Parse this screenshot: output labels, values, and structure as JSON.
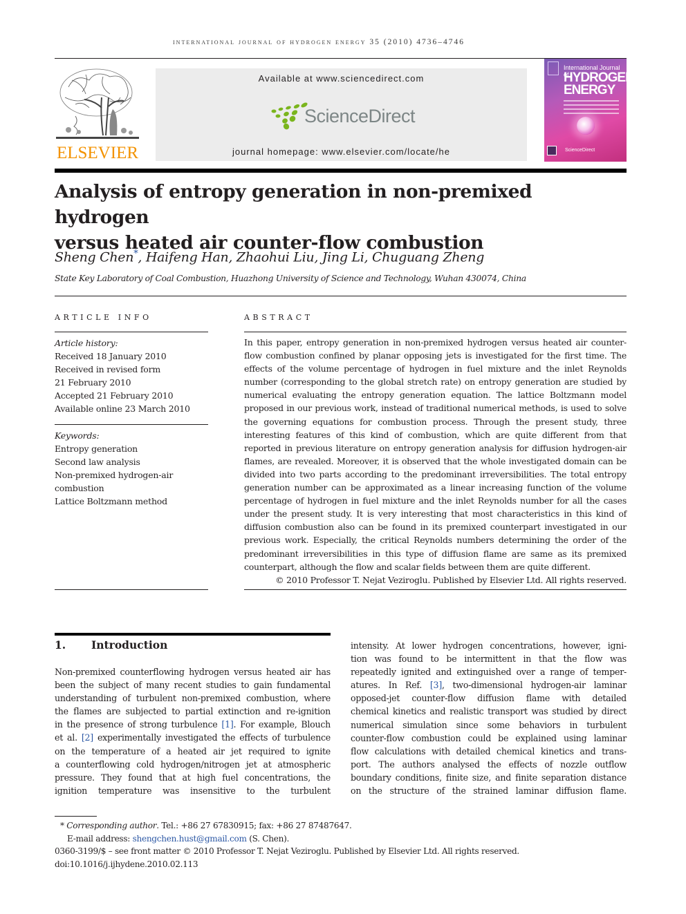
{
  "header": {
    "running_head": "international journal of hydrogen energy 35 (2010) 4736–4746",
    "publisher_logo_text": "ELSEVIER",
    "available_at": "Available at www.sciencedirect.com",
    "sciencedirect_logo_text": "ScienceDirect",
    "journal_homepage": "journal homepage: www.elsevier.com/locate/he",
    "cover": {
      "line1": "International Journal of",
      "line2": "HYDROGEN",
      "line3": "ENERGY",
      "footer": "ScienceDirect"
    }
  },
  "article": {
    "title_line1": "Analysis of entropy generation in non-premixed hydrogen",
    "title_line2": "versus heated air counter-flow combustion",
    "authors": [
      {
        "name": "Sheng Chen",
        "corresponding": true
      },
      {
        "name": "Haifeng Han"
      },
      {
        "name": "Zhaohui Liu"
      },
      {
        "name": "Jing Li"
      },
      {
        "name": "Chuguang Zheng"
      }
    ],
    "authors_display_first": "Sheng Chen",
    "authors_display_rest": ", Haifeng Han, Zhaohui Liu, Jing Li, Chuguang Zheng",
    "corresponding_marker": "*",
    "affiliation": "State Key Laboratory of Coal Combustion, Huazhong University of Science and Technology, Wuhan 430074, China"
  },
  "article_info": {
    "label": "ARTICLE INFO",
    "history_label": "Article history:",
    "history": [
      "Received 18 January 2010",
      "Received in revised form",
      "21 February 2010",
      "Accepted 21 February 2010",
      "Available online 23 March 2010"
    ],
    "keywords_label": "Keywords:",
    "keywords": [
      "Entropy generation",
      "Second law analysis",
      "Non-premixed hydrogen-air",
      "combustion",
      "Lattice Boltzmann method"
    ]
  },
  "abstract": {
    "label": "ABSTRACT",
    "text": "In this paper, entropy generation in non-premixed hydrogen versus heated air counter-flow combustion confined by planar opposing jets is investigated for the first time. The effects of the volume percentage of hydrogen in fuel mixture and the inlet Reynolds number (corresponding to the global stretch rate) on entropy generation are studied by numerical evaluating the entropy generation equation. The lattice Boltzmann model proposed in our previous work, instead of traditional numerical methods, is used to solve the governing equations for combustion process. Through the present study, three interesting features of this kind of combustion, which are quite different from that reported in previous literature on entropy generation analysis for diffusion hydrogen-air flames, are revealed. Moreover, it is observed that the whole investigated domain can be divided into two parts according to the predominant irreversibilities. The total entropy generation number can be approximated as a linear increasing function of the volume percentage of hydrogen in fuel mixture and the inlet Reynolds number for all the cases under the present study. It is very interesting that most characteristics in this kind of diffusion combustion also can be found in its premixed counterpart investigated in our previous work. Especially, the critical Reynolds numbers determining the order of the predominant irreversibilities in this type of diffusion flame are same as its premixed counterpart, although the flow and scalar fields between them are quite different.",
    "copyright": "© 2010 Professor T. Nejat Veziroglu. Published by Elsevier Ltd. All rights reserved."
  },
  "introduction": {
    "number": "1.",
    "heading": "Introduction",
    "left_lines": [
      {
        "text": "Non-premixed counterflowing hydrogen versus heated air has"
      },
      {
        "text": "been the subject of many recent studies to gain fundamental"
      },
      {
        "text": "understanding of turbulent non-premixed combustion, where"
      },
      {
        "text": "the flames are subjected to partial extinction and re-ignition"
      },
      {
        "pre": "in the presence of strong turbulence ",
        "ref": "[1]",
        "post": ". For example, Blouch"
      },
      {
        "pre": "et al. ",
        "ref": "[2]",
        "post": " experimentally investigated the effects of turbulence"
      },
      {
        "text": "on the temperature of a heated air jet required to ignite"
      },
      {
        "text": "a counterflowing cold hydrogen/nitrogen jet at atmospheric"
      },
      {
        "text": "pressure. They found that at high fuel concentrations, the"
      },
      {
        "text": "ignition temperature was insensitive to the turbulent"
      }
    ],
    "right_lines": [
      {
        "text": "intensity. At lower hydrogen concentrations, however, igni-"
      },
      {
        "text": "tion was found to be intermittent in that the flow was"
      },
      {
        "text": "repeatedly ignited and extinguished over a range of temper-"
      },
      {
        "pre": "atures. In Ref. ",
        "ref": "[3]",
        "post": ", two-dimensional hydrogen-air laminar"
      },
      {
        "text": "opposed-jet counter-flow diffusion flame with detailed"
      },
      {
        "text": "chemical kinetics and realistic transport was studied by direct"
      },
      {
        "text": "numerical simulation since some behaviors in turbulent"
      },
      {
        "text": "counter-flow combustion could be explained using laminar"
      },
      {
        "text": "flow calculations with detailed chemical kinetics and trans-"
      },
      {
        "text": "port. The authors analysed the effects of nozzle outflow"
      },
      {
        "text": "boundary conditions, finite size, and finite separation distance"
      },
      {
        "text": "on the structure of the strained laminar diffusion flame."
      }
    ]
  },
  "footnotes": {
    "marker": "*",
    "corresponding_label": "Corresponding author",
    "contact": ". Tel.: +86 27 67830915; fax: +86 27 87487647.",
    "email_label": "E-mail address: ",
    "email": "shengchen.hust@gmail.com",
    "email_suffix": " (S. Chen).",
    "front_matter": "0360-3199/$ – see front matter © 2010 Professor T. Nejat Veziroglu. Published by Elsevier Ltd. All rights reserved.",
    "doi": "doi:10.1016/j.ijhydene.2010.02.113"
  },
  "colors": {
    "elsevier_orange": "#f39200",
    "sciencedirect_green": "#7ab51d",
    "link_blue": "#2b57a4"
  }
}
